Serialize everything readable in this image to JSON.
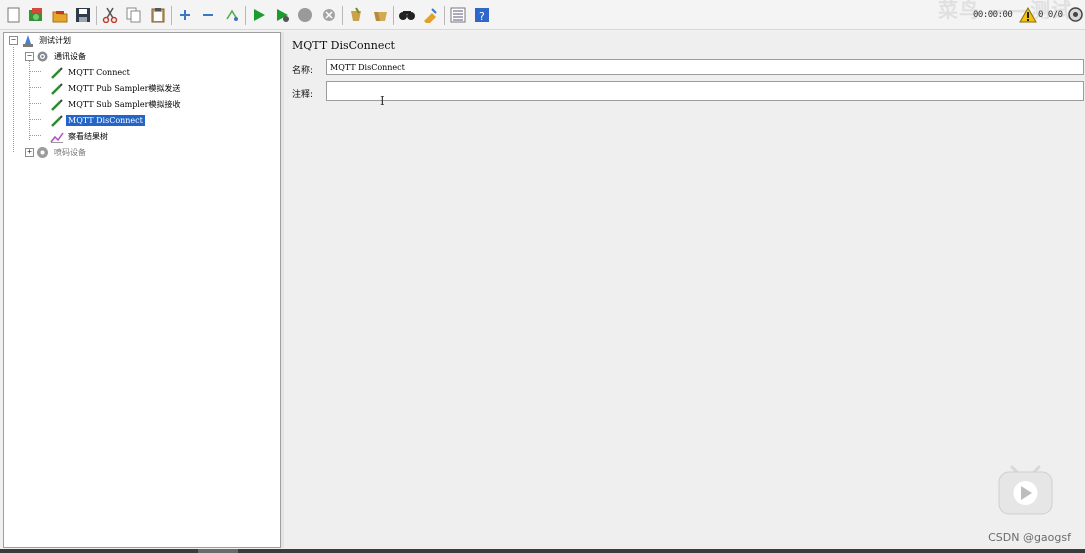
{
  "toolbar": {
    "buttons": [
      {
        "name": "new-icon",
        "label": "New"
      },
      {
        "name": "templates-icon",
        "label": "Templates"
      },
      {
        "name": "open-icon",
        "label": "Open"
      },
      {
        "name": "save-icon",
        "label": "Save"
      },
      {
        "name": "cut-icon",
        "label": "Cut"
      },
      {
        "name": "copy-icon",
        "label": "Copy"
      },
      {
        "name": "paste-icon",
        "label": "Paste"
      },
      {
        "name": "expand-all-icon",
        "label": "Expand"
      },
      {
        "name": "collapse-all-icon",
        "label": "Collapse"
      },
      {
        "name": "toggle-icon",
        "label": "Toggle"
      },
      {
        "name": "start-icon",
        "label": "Start"
      },
      {
        "name": "start-no-pauses-icon",
        "label": "Start no pauses"
      },
      {
        "name": "stop-icon",
        "label": "Stop"
      },
      {
        "name": "shutdown-icon",
        "label": "Shutdown"
      },
      {
        "name": "clear-icon",
        "label": "Clear"
      },
      {
        "name": "clear-all-icon",
        "label": "Clear all"
      },
      {
        "name": "search-icon",
        "label": "Search"
      },
      {
        "name": "reset-search-icon",
        "label": "Reset search"
      },
      {
        "name": "function-helper-icon",
        "label": "Function helper"
      },
      {
        "name": "help-icon",
        "label": "Help"
      }
    ],
    "timer": "00:00:00",
    "warnings": "0  0/0",
    "watermark": "菜鸟  ——测试"
  },
  "tree": {
    "test_plan": "测试计划",
    "thread_group": "通讯设备",
    "items": [
      {
        "label": "MQTT Connect"
      },
      {
        "label": "MQTT Pub Sampler模拟发送"
      },
      {
        "label": "MQTT Sub Sampler模拟接收"
      },
      {
        "label": "MQTT DisConnect"
      }
    ],
    "listener": "察看结果树",
    "disabled_group": "喷码设备"
  },
  "panel": {
    "title": "MQTT DisConnect",
    "name_label": "名称:",
    "name_value": "MQTT DisConnect",
    "comment_label": "注释:",
    "comment_value": ""
  },
  "overlay": {
    "csdn": "CSDN @gaogsf"
  },
  "colors": {
    "selection": "#2264c8",
    "start_green": "#1a9c2e",
    "panel_bg": "#efefef"
  }
}
